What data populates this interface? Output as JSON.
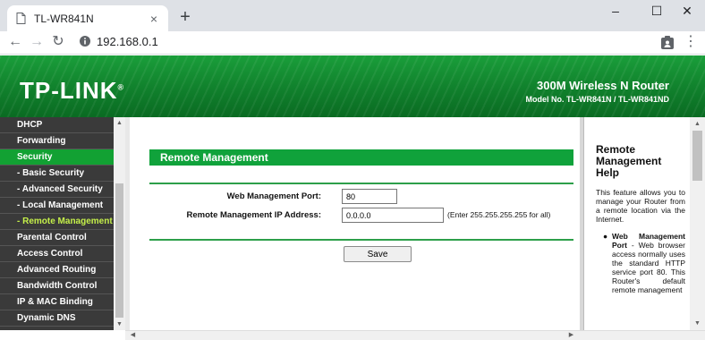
{
  "browser": {
    "tab_title": "TL-WR841N",
    "tab_close": "×",
    "new_tab": "+",
    "url": "192.168.0.1",
    "window_controls": {
      "minimize": "–",
      "maximize": "☐",
      "close": "✕"
    },
    "nav": {
      "back": "←",
      "forward": "→",
      "reload": "↻",
      "menu": "⋮"
    }
  },
  "header": {
    "logo": "TP-LINK",
    "logo_mark": "®",
    "product": "300M Wireless N Router",
    "model": "Model No. TL-WR841N / TL-WR841ND"
  },
  "menu": {
    "items": [
      {
        "label": "DHCP"
      },
      {
        "label": "Forwarding"
      },
      {
        "label": "Security"
      },
      {
        "label": "- Basic Security"
      },
      {
        "label": "- Advanced Security"
      },
      {
        "label": "- Local Management"
      },
      {
        "label": "- Remote Management"
      },
      {
        "label": "Parental Control"
      },
      {
        "label": "Access Control"
      },
      {
        "label": "Advanced Routing"
      },
      {
        "label": "Bandwidth Control"
      },
      {
        "label": "IP & MAC Binding"
      },
      {
        "label": "Dynamic DNS"
      }
    ],
    "active": "Security",
    "selected_sub": "- Remote Management"
  },
  "main": {
    "section_title": "Remote Management",
    "port_label": "Web Management Port:",
    "port_value": "80",
    "ip_label": "Remote Management IP Address:",
    "ip_value": "0.0.0.0",
    "ip_hint": "(Enter 255.255.255.255 for all)",
    "save_label": "Save"
  },
  "help": {
    "title": "Remote Management Help",
    "intro": "This feature allows you to manage your Router from a remote location via the Internet.",
    "bullet_term": "Web Management Port",
    "bullet_text": " - Web browser access normally uses the standard HTTP service port 80. This Router's default remote management"
  },
  "colors": {
    "brand_green": "#10a23b",
    "menu_bg": "#3a3a3a",
    "selected_sub_text": "#c5f04a"
  }
}
